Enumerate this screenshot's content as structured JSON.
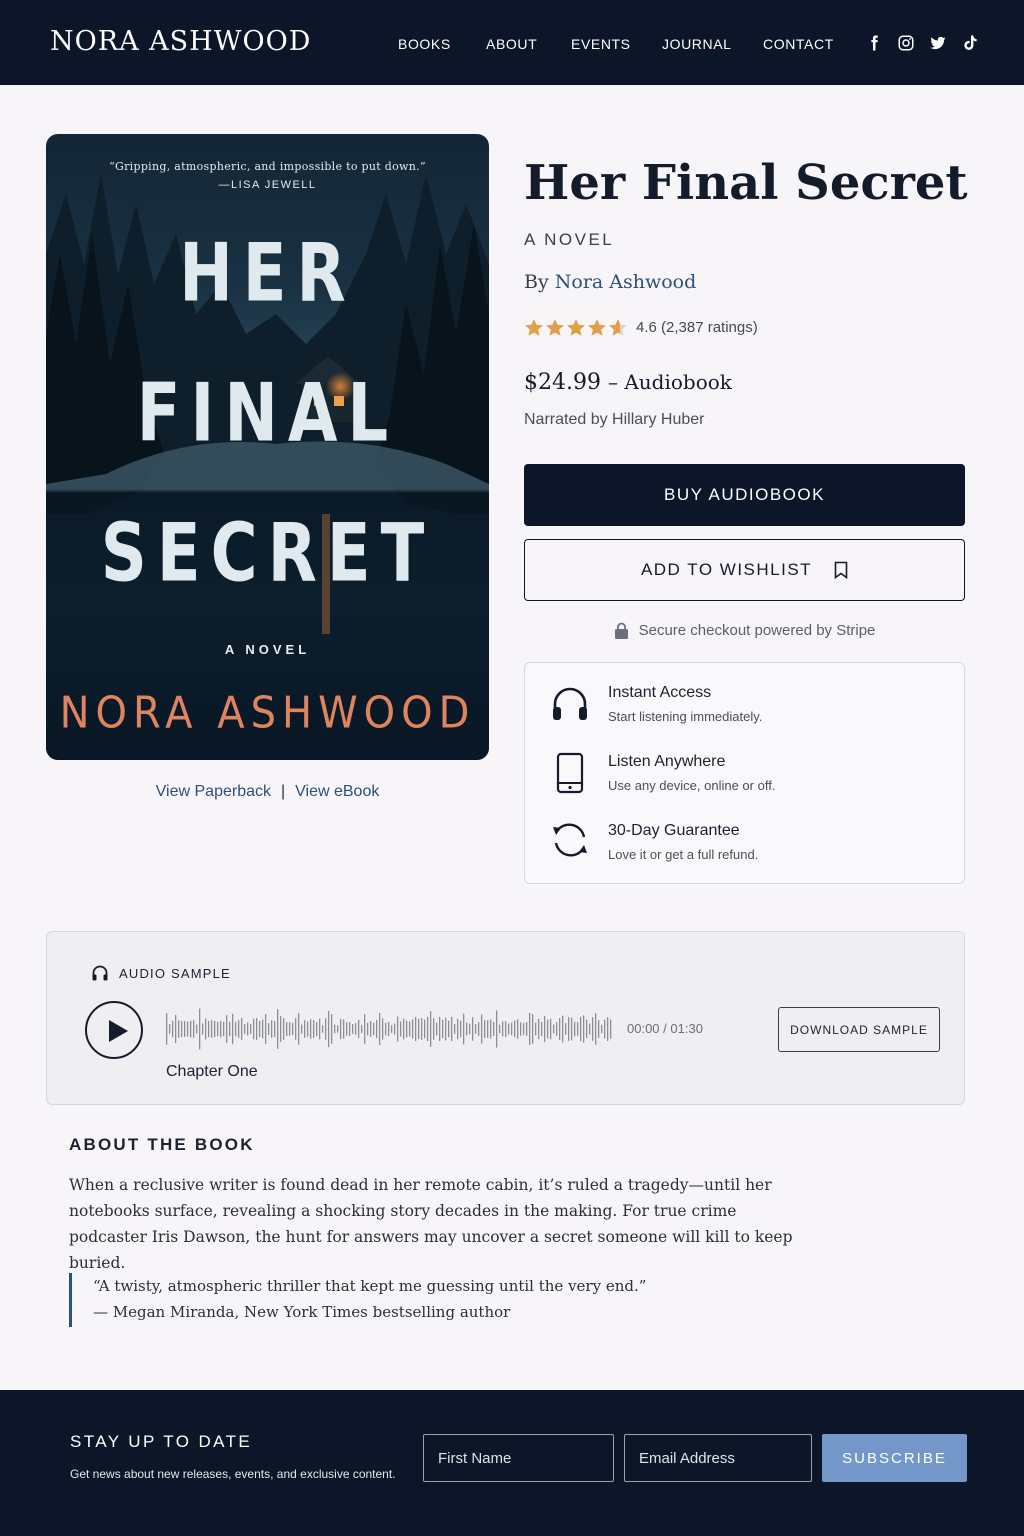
{
  "header": {
    "brand": "NORA ASHWOOD",
    "nav": [
      "BOOKS",
      "ABOUT",
      "EVENTS",
      "JOURNAL",
      "CONTACT"
    ],
    "social": [
      "facebook-icon",
      "instagram-icon",
      "twitter-icon",
      "tiktok-icon"
    ]
  },
  "cover": {
    "blurb": "“Gripping, atmospheric, and impossible to put down.”",
    "blurb_attribution": "—LISA JEWELL",
    "title_lines": [
      "HER",
      "FINAL",
      "SECRET"
    ],
    "subtitle": "A NOVEL",
    "author": "NORA ASHWOOD"
  },
  "editions": {
    "paperback": "View Paperback",
    "separator": "|",
    "ebook": "View eBook"
  },
  "book": {
    "title": "Her Final Secret",
    "subtitle": "A NOVEL",
    "by_prefix": "By",
    "author": "Nora Ashwood",
    "rating_value": 4.6,
    "rating_text": "4.6 (2,387 ratings)",
    "price": "$24.99",
    "format": "– Audiobook",
    "narrator": "Narrated by Hillary Huber"
  },
  "actions": {
    "buy": "BUY AUDIOBOOK",
    "wishlist": "ADD TO WISHLIST",
    "secure": "Secure checkout powered by Stripe"
  },
  "features": [
    {
      "icon": "headphones-icon",
      "title": "Instant Access",
      "desc": "Start listening immediately."
    },
    {
      "icon": "smartphone-icon",
      "title": "Listen Anywhere",
      "desc": "Use any device, online or off."
    },
    {
      "icon": "refresh-icon",
      "title": "30-Day Guarantee",
      "desc": "Love it or get a full refund."
    }
  ],
  "audio": {
    "label": "AUDIO SAMPLE",
    "current_time": "00:00",
    "separator": "/",
    "total_time": "01:30",
    "chapter": "Chapter One",
    "download": "DOWNLOAD SAMPLE",
    "progress": 0
  },
  "about": {
    "heading": "ABOUT THE BOOK",
    "body": "When a reclusive writer is found dead in her remote cabin, it’s ruled a tragedy—until her notebooks surface, revealing a shocking story decades in the making. For true crime podcaster Iris Dawson, the hunt for answers may uncover a secret someone will kill to keep buried.",
    "quote": "“A twisty, atmospheric thriller that kept me guessing until the very end.”",
    "quote_attribution": "— Megan Miranda, New York Times bestselling author"
  },
  "newsletter": {
    "heading": "STAY UP TO DATE",
    "description": "Get news about new releases, events, and exclusive content.",
    "first_name_placeholder": "First Name",
    "email_placeholder": "Email Address",
    "subscribe": "SUBSCRIBE"
  },
  "colors": {
    "navy": "#0d1628",
    "link": "#2c4f7c",
    "star": "#e0a04a",
    "cover_author": "#e0845f",
    "subscribe": "#7397c8"
  }
}
